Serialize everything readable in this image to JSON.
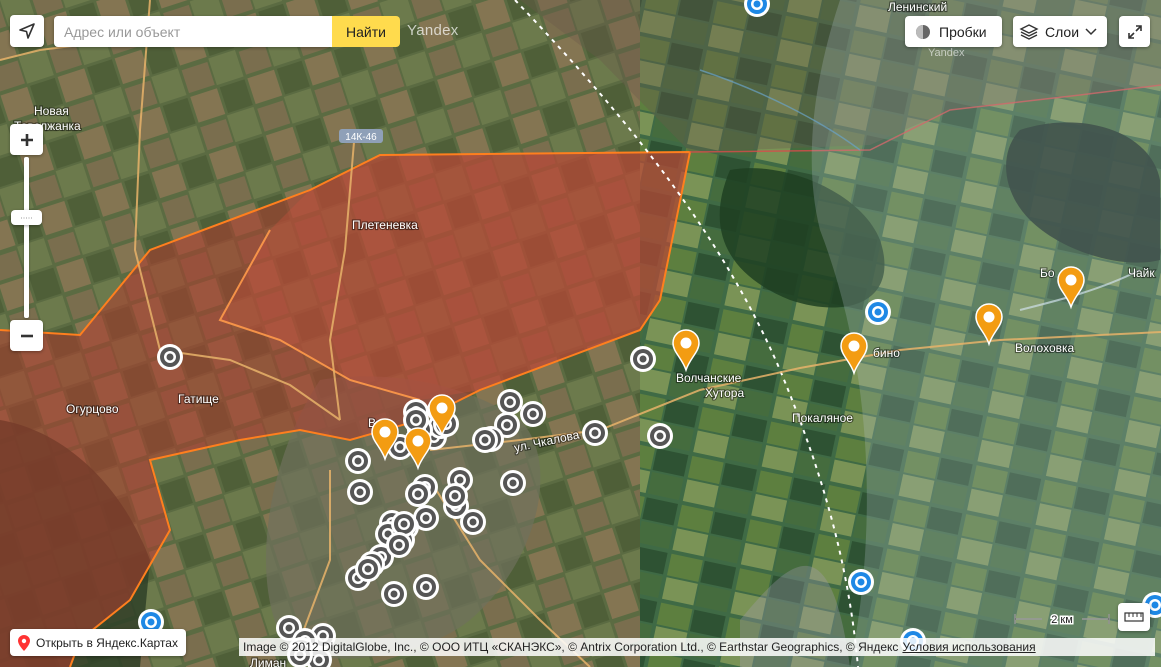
{
  "search": {
    "placeholder": "Адрес или объект",
    "button": "Найти"
  },
  "brand": "Yandex",
  "controls": {
    "traffic": "Пробки",
    "layers": "Слои",
    "open_maps": "Открыть в Яндекс.Картах"
  },
  "scale_label": "2 км",
  "copyright": "Image © 2012 DigitalGlobe, Inc., © ООО ИТЦ «СКАНЭКС», © Antrix Corporation Ltd., © Earthstar Geographics, © Яндекс",
  "terms_link": "Условия использования",
  "map_labels": {
    "novaya": "Новая",
    "tavolzhanka": "Таволжанка",
    "road_ref": "14К-46",
    "pletenevka": "Плетеневка",
    "ogurtsovo": "Огурцово",
    "gatishche": "Гатище",
    "volchanskie": "Волчанские",
    "khutora": "Хутора",
    "pokalyanoe": "Покаляное",
    "volokhovka": "Волоховка",
    "leninsky": "Ленинский",
    "yandex_small": "Yandex",
    "ul_chkalova": "ул. Чкалова",
    "vol": "Вол",
    "bo": "Бо",
    "chaik": "Чайк",
    "bino": "бино",
    "liman": "Лиман"
  },
  "colors": {
    "red_zone": "#c0392b",
    "orange_border": "#ff7f1e",
    "blue_marker": "#1e88e5",
    "orange_marker": "#f39c12",
    "search_button": "#ffdb4d"
  },
  "markers": {
    "gray_count": 45,
    "orange_count": 7,
    "blue_count": 6
  }
}
